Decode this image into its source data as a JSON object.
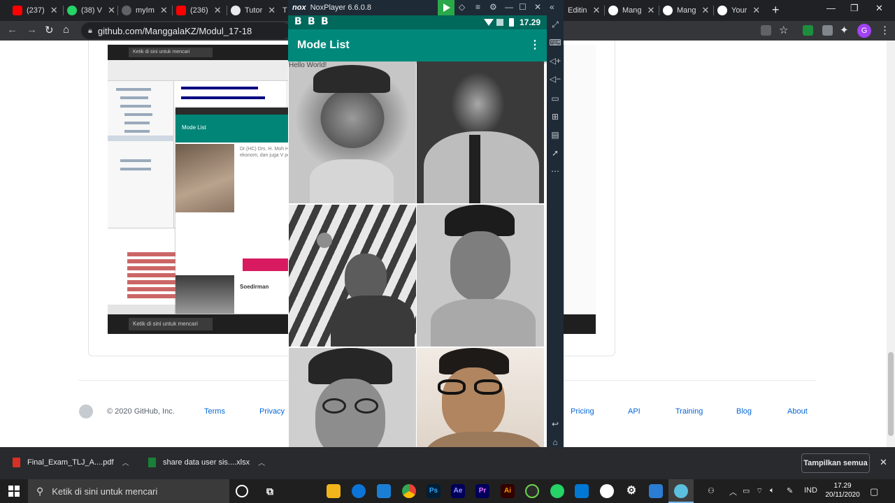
{
  "browser": {
    "tabs": [
      {
        "label": "(237)",
        "color": "#ff0000"
      },
      {
        "label": "(38) V",
        "color": "#25d366"
      },
      {
        "label": "myIm",
        "color": "#5f6368"
      },
      {
        "label": "(236)",
        "color": "#ff0000"
      },
      {
        "label": "Tutor",
        "color": "#e8eaed"
      },
      {
        "label": "T",
        "color": "#5f6368"
      },
      {
        "label": "Editin",
        "color": "#5f6368"
      },
      {
        "label": "Mang",
        "color": "#ffffff"
      },
      {
        "label": "Mang",
        "color": "#ffffff"
      },
      {
        "label": "Your",
        "color": "#ffffff"
      }
    ],
    "close_glyph": "✕",
    "new_tab": "+",
    "url": "github.com/ManggalaKZ/Modul_17-18",
    "profile_initial": "G"
  },
  "github": {
    "copyright": "© 2020 GitHub, Inc.",
    "footer_links": [
      "Terms",
      "Privacy",
      "Pricing",
      "API",
      "Training",
      "Blog",
      "About"
    ]
  },
  "embedded_screenshot": {
    "taskbar_search": "Ketik di sini untuk mencari",
    "app_title": "Mode List",
    "hero_text": "Dr.(HC) Drs. H. Moh Hatta; lahir di Fort de ~ meninggal di Jak ekonom, dan juga V peranan penting un",
    "hero_name": "Soedirman"
  },
  "nox": {
    "title": "NoxPlayer 6.6.0.8",
    "logo": "nox",
    "status_icons": [
      "B",
      "B",
      "B"
    ],
    "time": "17.29",
    "app_title": "Mode List",
    "overflow_icon": "⋮",
    "ghost_text": "Hello World!",
    "heroes": [
      {
        "name": "hero-1",
        "tone": "#7a7a7a"
      },
      {
        "name": "hero-2",
        "tone": "#6b6b6b"
      },
      {
        "name": "hero-3",
        "tone": "#5a5a5a"
      },
      {
        "name": "hero-4",
        "tone": "#8a8a8a"
      },
      {
        "name": "hero-5",
        "tone": "#7d7d7d"
      },
      {
        "name": "hero-6",
        "tone": "#a88a72"
      }
    ]
  },
  "downloads": [
    {
      "file": "Final_Exam_TLJ_A....pdf",
      "color": "#d93025"
    },
    {
      "file": "share data user sis....xlsx",
      "color": "#188038"
    }
  ],
  "downloads_show_all": "Tampilkan semua",
  "taskbar": {
    "search_placeholder": "Ketik di sini untuk mencari",
    "apps": [
      "Ps",
      "Ae",
      "Pr",
      "Ai"
    ],
    "language": "IND",
    "time": "17.29",
    "date": "20/11/2020"
  }
}
